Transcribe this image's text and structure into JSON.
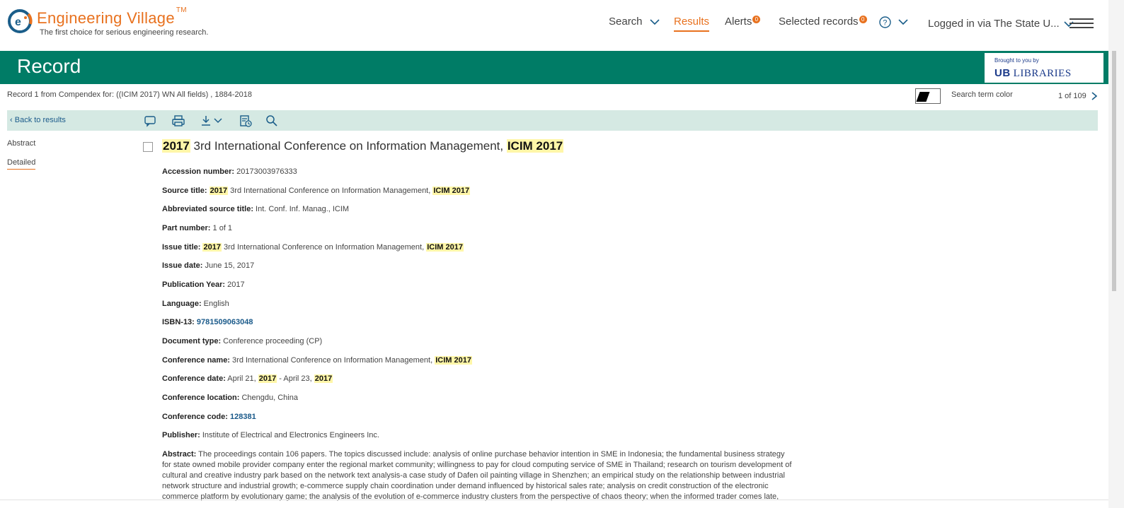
{
  "header": {
    "logo_name": "Engineering Village",
    "logo_tm": "TM",
    "tagline": "The first choice for serious engineering research.",
    "nav": {
      "search": "Search",
      "results": "Results",
      "alerts": "Alerts",
      "alerts_count": "0",
      "selected": "Selected records",
      "selected_count": "0",
      "login": "Logged in via The State U..."
    }
  },
  "banner": {
    "title": "Record",
    "brought_by": "Brought to you by",
    "library_logo_mark": "UB",
    "library_name": "LIBRARIES"
  },
  "record_bar": {
    "info": "Record 1 from Compendex for: ((ICIM 2017) WN All fields) , 1884-2018",
    "search_term_color": "Search term color",
    "pager": "1 of 109"
  },
  "toolbar": {
    "back": "Back to results"
  },
  "sidenav": {
    "abstract": "Abstract",
    "detailed": "Detailed"
  },
  "record": {
    "title_part1": "2017",
    "title_part2": " 3rd International Conference on Information Management, ",
    "title_part3": "ICIM 2017",
    "accession_label": "Accession number:",
    "accession_value": " 20173003976333",
    "source_label": "Source title:",
    "source_hl1": "2017",
    "source_mid": " 3rd International Conference on Information Management, ",
    "source_hl2": "ICIM 2017",
    "abbr_label": "Abbreviated source title:",
    "abbr_value": " Int. Conf. Inf. Manag., ICIM",
    "part_label": "Part number:",
    "part_value": " 1 of 1",
    "issue_title_label": "Issue title:",
    "issue_hl1": "2017",
    "issue_mid": " 3rd International Conference on Information Management, ",
    "issue_hl2": "ICIM 2017",
    "issue_date_label": "Issue date:",
    "issue_date_value": " June 15, 2017",
    "pubyear_label": "Publication Year:",
    "pubyear_value": " 2017",
    "language_label": "Language:",
    "language_value": " English",
    "isbn_label": "ISBN-13:",
    "isbn_value": "9781509063048",
    "doctype_label": "Document type:",
    "doctype_value": " Conference proceeding (CP)",
    "confname_label": "Conference name:",
    "confname_mid": " 3rd International Conference on Information Management, ",
    "confname_hl": "ICIM 2017",
    "confdate_label": "Conference date:",
    "confdate_a": " April 21, ",
    "confdate_hl1": "2017",
    "confdate_b": " - April 23, ",
    "confdate_hl2": "2017",
    "confloc_label": "Conference location:",
    "confloc_value": " Chengdu, China",
    "confcode_label": "Conference code:",
    "confcode_value": "128381",
    "publisher_label": "Publisher:",
    "publisher_value": " Institute of Electrical and Electronics Engineers Inc.",
    "abstract_label": "Abstract:",
    "abstract_value": " The proceedings contain 106 papers. The topics discussed include: analysis of online purchase behavior intention in SME in Indonesia; the fundamental business strategy for state owned mobile provider company enter the regional market community; willingness to pay for cloud computing service of SME in Thailand; research on tourism development of cultural and creative industry park based on the network text analysis-a case study of Dafen oil painting village in Shenzhen; an empirical study on the relationship between industrial network structure and industrial growth; e-commerce supply chain coordination under demand influenced by historical sales rate; analysis on credit construction of the electronic commerce platform by evolutionary game; the analysis of the evolution of e-commerce industry clusters from the perspective of chaos theory; when the informed trader comes late,"
  },
  "colors": {
    "accent": "#e8711e",
    "banner": "#007c66",
    "toolbar": "#d5e9e3",
    "highlight": "#fff6a8",
    "link": "#1a5a8a"
  }
}
